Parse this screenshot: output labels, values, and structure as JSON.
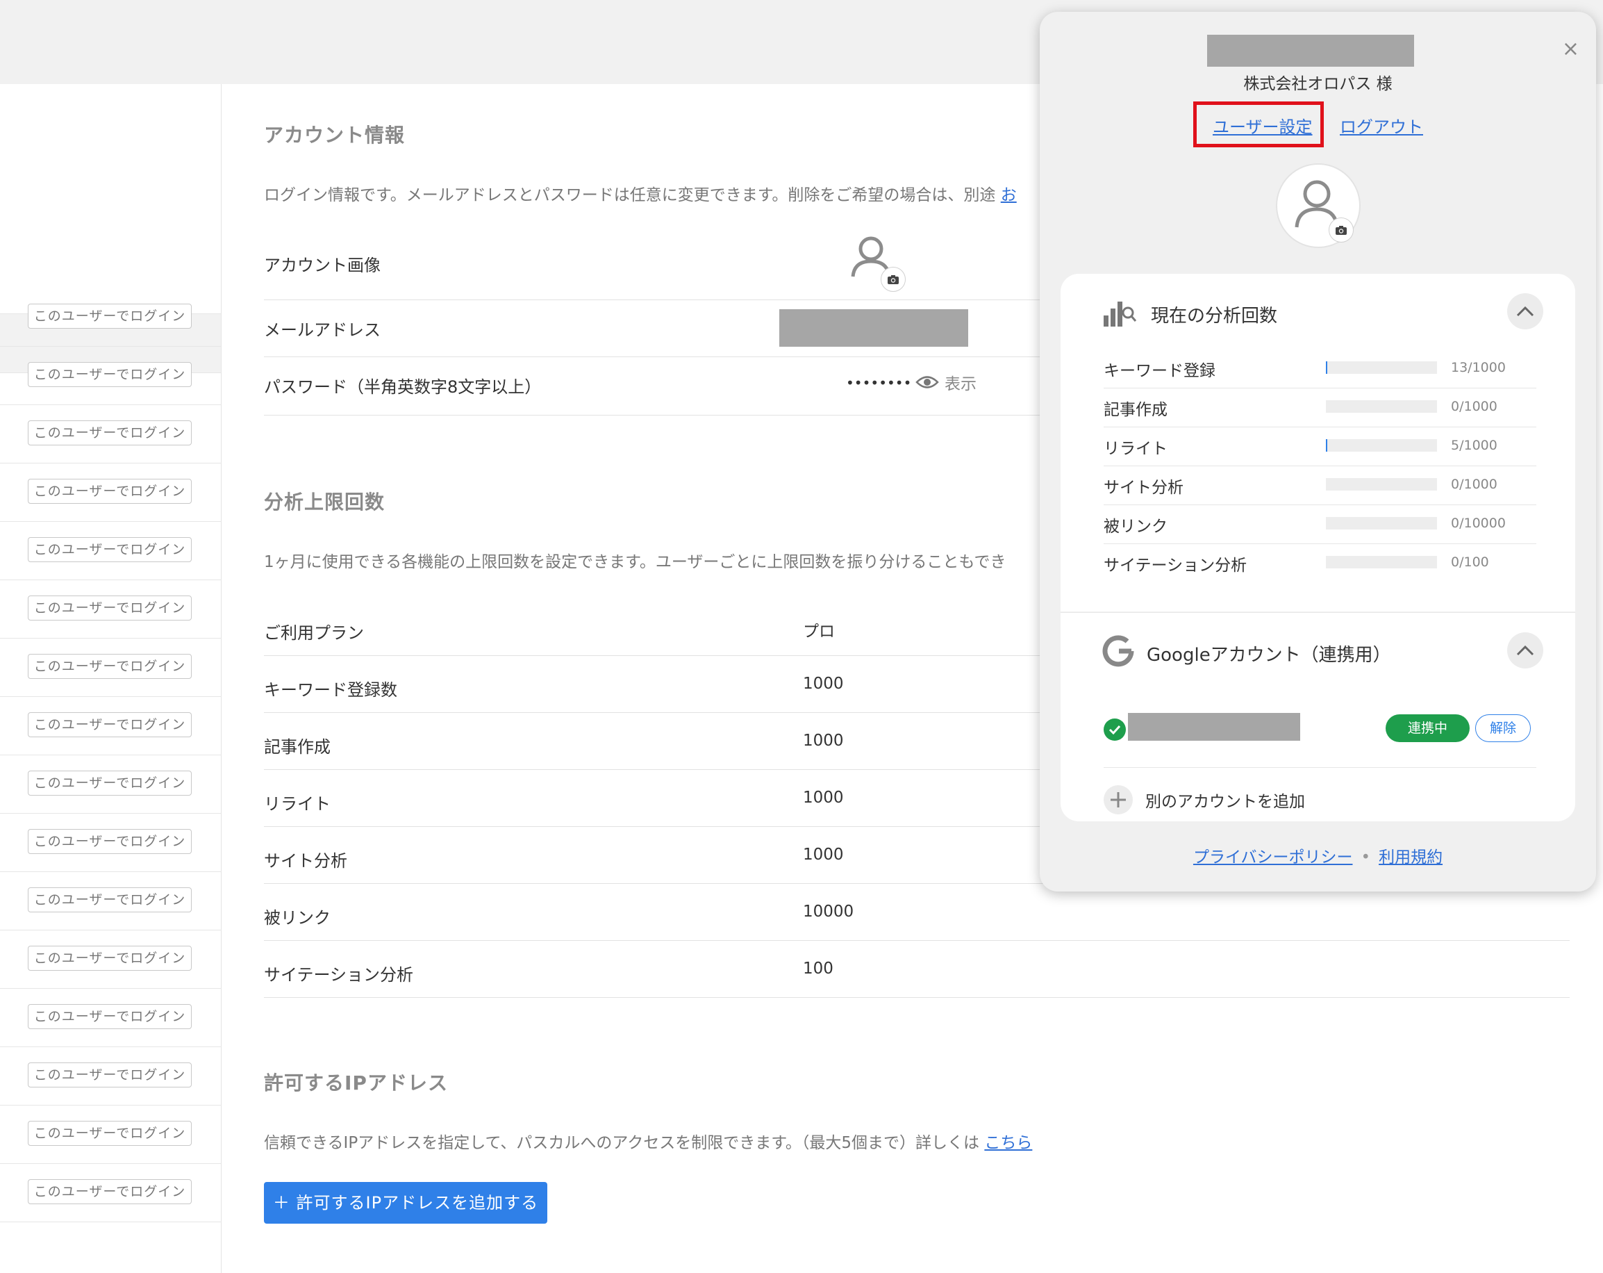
{
  "sidebar": {
    "login_button_label": "このユーザーでログイン"
  },
  "account": {
    "title": "アカウント情報",
    "description": "ログイン情報です。メールアドレスとパスワードは任意に変更できます。削除をご希望の場合は、別途",
    "description_link": "お",
    "image_label": "アカウント画像",
    "email_label": "メールアドレス",
    "password_label": "パスワード（半角英数字8文字以上）",
    "password_value": "••••••••",
    "show_label": "表示"
  },
  "limits": {
    "title": "分析上限回数",
    "description": "1ヶ月に使用できる各機能の上限回数を設定できます。ユーザーごとに上限回数を振り分けることもでき",
    "rows": [
      {
        "label": "ご利用プラン",
        "value": "プロ"
      },
      {
        "label": "キーワード登録数",
        "value": "1000"
      },
      {
        "label": "記事作成",
        "value": "1000"
      },
      {
        "label": "リライト",
        "value": "1000"
      },
      {
        "label": "サイト分析",
        "value": "1000"
      },
      {
        "label": "被リンク",
        "value": "10000"
      },
      {
        "label": "サイテーション分析",
        "value": "100"
      }
    ]
  },
  "ip": {
    "title": "許可するIPアドレス",
    "description": "信頼できるIPアドレスを指定して、パスカルへのアクセスを制限できます。（最大5個まで）詳しくは",
    "link": "こちら",
    "add_button": "＋ 許可するIPアドレスを追加する"
  },
  "popup": {
    "close": "×",
    "company": "株式会社オロパス 様",
    "user_settings": "ユーザー設定",
    "logout": "ログアウト",
    "usage_title": "現在の分析回数",
    "usage": [
      {
        "label": "キーワード登録",
        "count": "13/1000",
        "ratio": 0.013
      },
      {
        "label": "記事作成",
        "count": "0/1000",
        "ratio": 0
      },
      {
        "label": "リライト",
        "count": "5/1000",
        "ratio": 0.005
      },
      {
        "label": "サイト分析",
        "count": "0/1000",
        "ratio": 0
      },
      {
        "label": "被リンク",
        "count": "0/10000",
        "ratio": 0
      },
      {
        "label": "サイテーション分析",
        "count": "0/100",
        "ratio": 0
      }
    ],
    "google_title": "Googleアカウント（連携用）",
    "linked_status": "連携中",
    "unlink": "解除",
    "add_account": "別のアカウントを追加",
    "privacy": "プライバシーポリシー",
    "terms": "利用規約"
  },
  "colors": {
    "accent": "#2f80e8",
    "highlight": "#e0111b",
    "success": "#1e9e4c",
    "link": "#2f6fd6"
  }
}
